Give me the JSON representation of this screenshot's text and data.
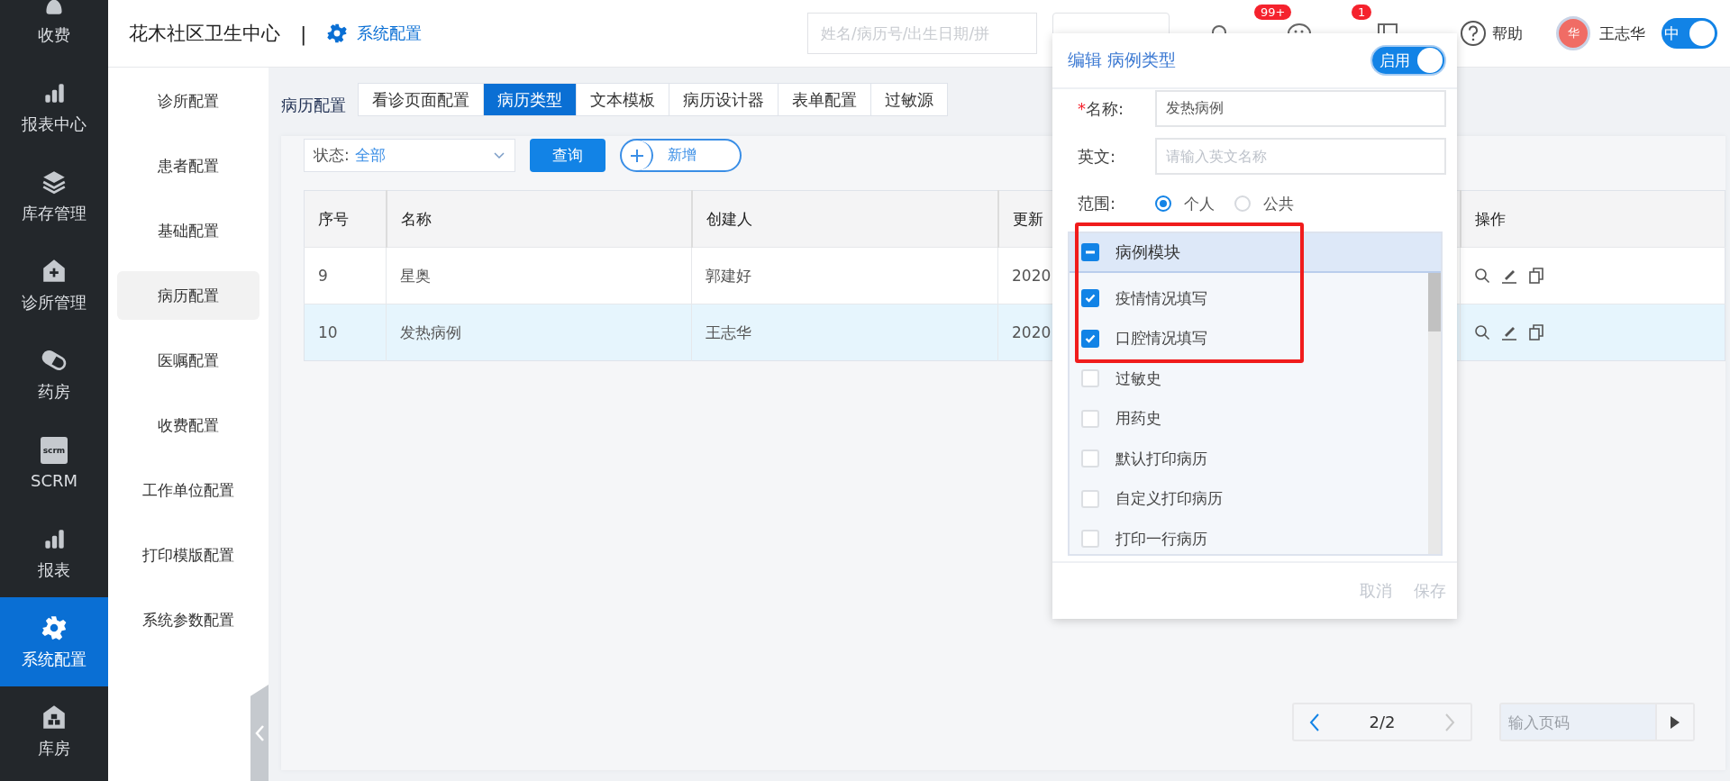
{
  "nav": {
    "items": [
      {
        "label": "收费",
        "kind": "money",
        "selected": false
      },
      {
        "label": "报表中心",
        "kind": "bars",
        "selected": false
      },
      {
        "label": "库存管理",
        "kind": "layers",
        "selected": false
      },
      {
        "label": "诊所管理",
        "kind": "clinic",
        "selected": false
      },
      {
        "label": "药房",
        "kind": "pill",
        "selected": false
      },
      {
        "label": "SCRM",
        "kind": "scrm",
        "icon_text": "scrm",
        "selected": false
      },
      {
        "label": "报表",
        "kind": "bars",
        "selected": false
      },
      {
        "label": "系统配置",
        "kind": "gear",
        "selected": true
      },
      {
        "label": "库房",
        "kind": "warehouse",
        "selected": false
      }
    ]
  },
  "header": {
    "clinic_name": "花木社区卫生中心",
    "separator": "|",
    "module": "系统配置",
    "search": {
      "placeholder": "姓名/病历号/出生日期/拼"
    },
    "notice_badge": "99+",
    "wechat_badge": "1",
    "help": "帮助",
    "avatar": "华",
    "user": "王志华",
    "language": {
      "label": "中",
      "on": true
    }
  },
  "settings_menu": {
    "items": [
      {
        "label": "诊所配置",
        "selected": false
      },
      {
        "label": "患者配置",
        "selected": false
      },
      {
        "label": "基础配置",
        "selected": false
      },
      {
        "label": "病历配置",
        "selected": true
      },
      {
        "label": "医嘱配置",
        "selected": false
      },
      {
        "label": "收费配置",
        "selected": false
      },
      {
        "label": "工作单位配置",
        "selected": false
      },
      {
        "label": "打印模版配置",
        "selected": false
      },
      {
        "label": "系统参数配置",
        "selected": false
      }
    ]
  },
  "section_title": "病历配置",
  "tabs": [
    {
      "label": "看诊页面配置",
      "selected": false
    },
    {
      "label": "病历类型",
      "selected": true
    },
    {
      "label": "文本模板",
      "selected": false
    },
    {
      "label": "病历设计器",
      "selected": false
    },
    {
      "label": "表单配置",
      "selected": false
    },
    {
      "label": "过敏源",
      "selected": false
    }
  ],
  "filter": {
    "label": "状态:",
    "value": "全部",
    "query_button": "查询",
    "add_button": "新增"
  },
  "table": {
    "columns": [
      "序号",
      "名称",
      "创建人",
      "更新",
      "操作"
    ],
    "rows": [
      {
        "cells": [
          "9",
          "星奥",
          "郭建好",
          "2020"
        ],
        "selected": false
      },
      {
        "cells": [
          "10",
          "发热病例",
          "王志华",
          "2020"
        ],
        "selected": true
      }
    ]
  },
  "pagination": {
    "page": "2/2",
    "prev_disabled": false,
    "next_disabled": true,
    "page_input": {
      "placeholder": "输入页码"
    }
  },
  "dialog": {
    "title": "编辑 病例类型",
    "enabled": {
      "label": "启用",
      "on": true
    },
    "name": {
      "required_mark": "*",
      "label": "名称:",
      "value": "发热病例"
    },
    "english": {
      "label": "英文:",
      "placeholder": "请输入英文名称"
    },
    "scope": {
      "label": "范围:",
      "options": [
        {
          "label": "个人",
          "selected": true
        },
        {
          "label": "公共",
          "selected": false
        }
      ]
    },
    "module_tree": {
      "label": "病例模块",
      "indeterminate": true,
      "children": [
        {
          "label": "疫情情况填写",
          "checked": true
        },
        {
          "label": "口腔情况填写",
          "checked": true
        },
        {
          "label": "过敏史",
          "checked": false
        },
        {
          "label": "用药史",
          "checked": false
        },
        {
          "label": "默认打印病历",
          "checked": false
        },
        {
          "label": "自定义打印病历",
          "checked": false
        },
        {
          "label": "打印一行病历",
          "checked": false
        }
      ]
    },
    "cancel_button": {
      "label": "取消",
      "disabled": true
    },
    "save_button": {
      "label": "保存",
      "disabled": true
    }
  }
}
